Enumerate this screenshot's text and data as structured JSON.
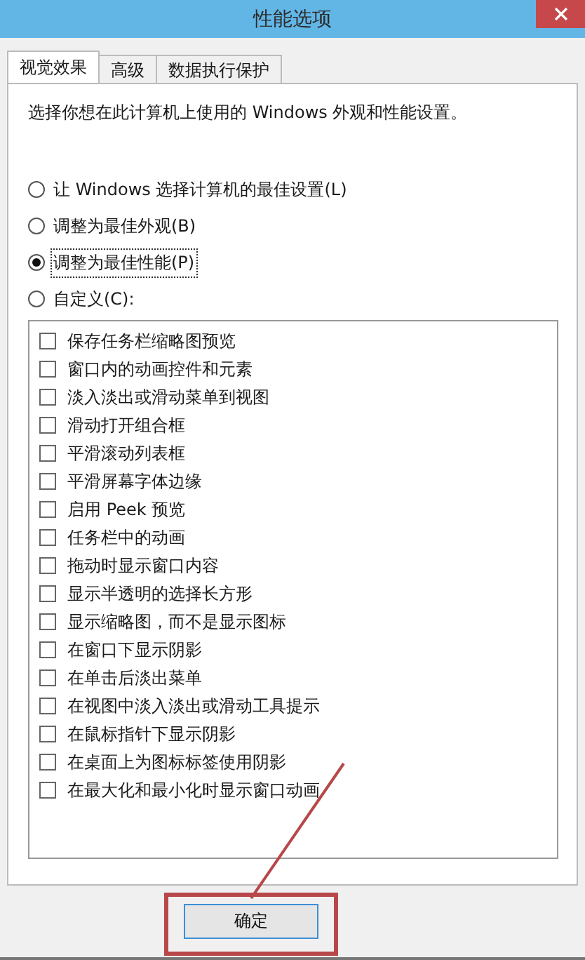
{
  "window": {
    "title": "性能选项"
  },
  "tabs": [
    {
      "label": "视觉效果",
      "selected": true
    },
    {
      "label": "高级",
      "selected": false
    },
    {
      "label": "数据执行保护",
      "selected": false
    }
  ],
  "description": "选择你想在此计算机上使用的 Windows 外观和性能设置。",
  "radios": [
    {
      "label": "让 Windows 选择计算机的最佳设置(L)",
      "selected": false
    },
    {
      "label": "调整为最佳外观(B)",
      "selected": false
    },
    {
      "label": "调整为最佳性能(P)",
      "selected": true
    },
    {
      "label": "自定义(C):",
      "selected": false
    }
  ],
  "options": [
    {
      "label": "保存任务栏缩略图预览",
      "checked": false
    },
    {
      "label": "窗口内的动画控件和元素",
      "checked": false
    },
    {
      "label": "淡入淡出或滑动菜单到视图",
      "checked": false
    },
    {
      "label": "滑动打开组合框",
      "checked": false
    },
    {
      "label": "平滑滚动列表框",
      "checked": false
    },
    {
      "label": "平滑屏幕字体边缘",
      "checked": false
    },
    {
      "label": "启用 Peek 预览",
      "checked": false
    },
    {
      "label": "任务栏中的动画",
      "checked": false
    },
    {
      "label": "拖动时显示窗口内容",
      "checked": false
    },
    {
      "label": "显示半透明的选择长方形",
      "checked": false
    },
    {
      "label": "显示缩略图，而不是显示图标",
      "checked": false
    },
    {
      "label": "在窗口下显示阴影",
      "checked": false
    },
    {
      "label": "在单击后淡出菜单",
      "checked": false
    },
    {
      "label": "在视图中淡入淡出或滑动工具提示",
      "checked": false
    },
    {
      "label": "在鼠标指针下显示阴影",
      "checked": false
    },
    {
      "label": "在桌面上为图标标签使用阴影",
      "checked": false
    },
    {
      "label": "在最大化和最小化时显示窗口动画",
      "checked": false
    }
  ],
  "buttons": [
    {
      "label": "确定"
    }
  ]
}
